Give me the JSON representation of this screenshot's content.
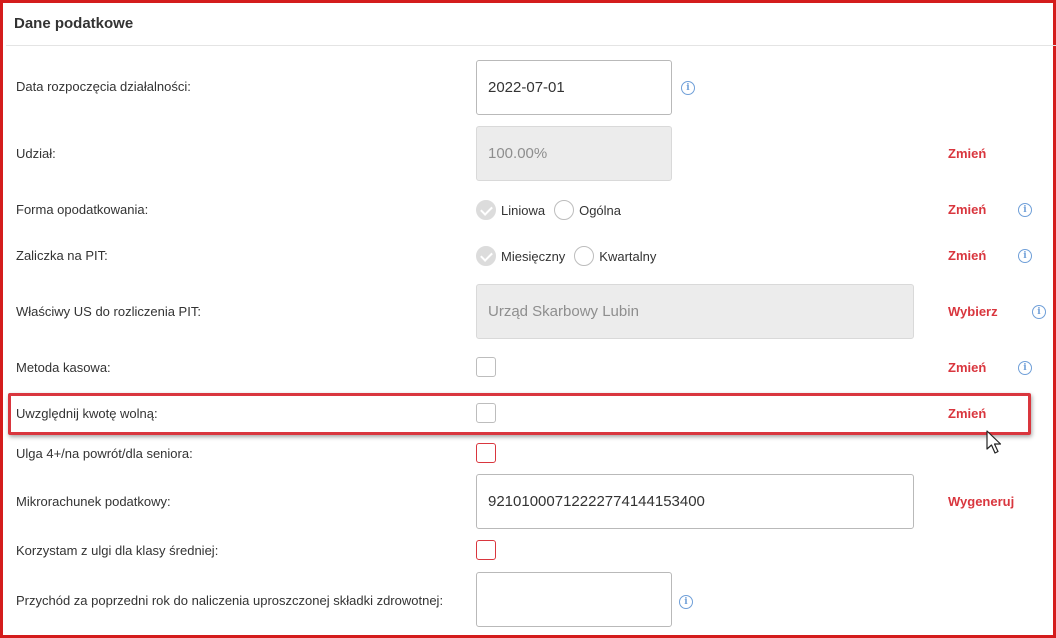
{
  "section": {
    "title": "Dane podatkowe"
  },
  "fields": {
    "start_date": {
      "label": "Data rozpoczęcia działalności:",
      "value": "2022-07-01"
    },
    "share": {
      "label": "Udział:",
      "value": "100.00%",
      "action": "Zmień"
    },
    "tax_form": {
      "label": "Forma opodatkowania:",
      "options": [
        "Liniowa",
        "Ogólna"
      ],
      "selected": "Liniowa",
      "action": "Zmień"
    },
    "pit_advance": {
      "label": "Zaliczka na PIT:",
      "options": [
        "Miesięczny",
        "Kwartalny"
      ],
      "selected": "Miesięczny",
      "action": "Zmień"
    },
    "tax_office": {
      "label": "Właściwy US do rozliczenia PIT:",
      "value": "Urząd Skarbowy Lubin",
      "action": "Wybierz"
    },
    "cash_method": {
      "label": "Metoda kasowa:",
      "checked": false,
      "action": "Zmień"
    },
    "tax_free_amount": {
      "label": "Uwzględnij kwotę wolną:",
      "checked": false,
      "action": "Zmień"
    },
    "relief": {
      "label": "Ulga 4+/na powrót/dla seniora:",
      "checked": false
    },
    "micro_account": {
      "label": "Mikrorachunek podatkowy:",
      "value": "92101000712222774144153400",
      "action": "Wygeneruj"
    },
    "middle_class": {
      "label": "Korzystam z ulgi dla klasy średniej:",
      "checked": false
    },
    "prev_income": {
      "label": "Przychód za poprzedni rok do naliczenia uproszczonej składki zdrowotnej:",
      "value": ""
    }
  },
  "icons": {
    "info": "info-icon",
    "cursor": "mouse-pointer-icon"
  },
  "colors": {
    "accent_red": "#d9363e",
    "info_blue": "#6f9fd8",
    "frame_red": "#d41c1c"
  }
}
